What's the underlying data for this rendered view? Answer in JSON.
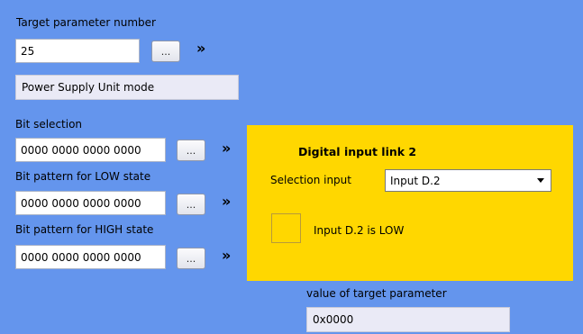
{
  "target": {
    "label": "Target parameter number",
    "value": "25",
    "browse_label": "...",
    "go_label": "»",
    "mode_text": "Power Supply Unit mode"
  },
  "bits": {
    "selection_label": "Bit selection",
    "selection_value": "0000 0000 0000 0000",
    "low_label": "Bit pattern for LOW state",
    "low_value": "0000 0000 0000 0000",
    "high_label": "Bit pattern for HIGH state",
    "high_value": "0000 0000 0000 0000",
    "browse_label": "...",
    "go_label": "»"
  },
  "link_panel": {
    "title": "Digital input link 2",
    "selection_label": "Selection input",
    "selection_value": "Input D.2",
    "state_text": "Input D.2 is LOW"
  },
  "result": {
    "label": "value of target parameter",
    "value": "0x0000"
  },
  "colors": {
    "background": "#6495ed",
    "panel": "#ffd700"
  },
  "icons": {
    "browse": "ellipsis-button",
    "go": "double-chevron-right",
    "dropdown": "triangle-down"
  }
}
